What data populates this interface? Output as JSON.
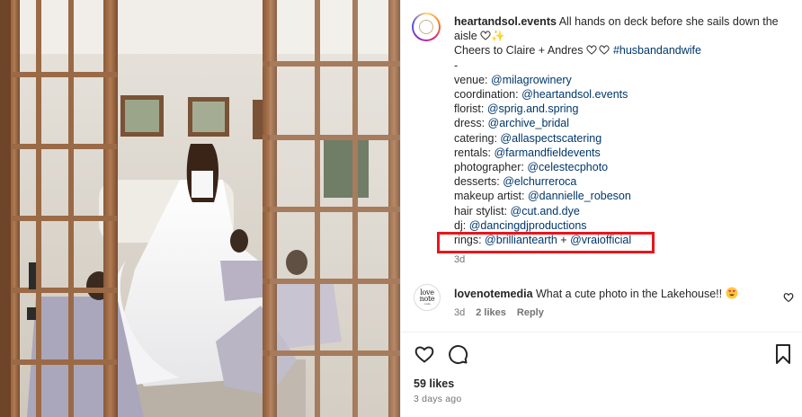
{
  "post": {
    "username": "heartandsol.events",
    "caption_text": " All hands on deck before she sails down the aisle ",
    "caption_emojis": "✨",
    "line_cheers": "Cheers to Claire + Andres ",
    "hashtag": "#husbandandwife",
    "dash": "-",
    "credits": [
      {
        "label": "venue: ",
        "mentions": [
          "@milagrowinery"
        ]
      },
      {
        "label": "coordination: ",
        "mentions": [
          "@heartandsol.events"
        ]
      },
      {
        "label": "florist: ",
        "mentions": [
          "@sprig.and.spring"
        ]
      },
      {
        "label": "dress: ",
        "mentions": [
          "@archive_bridal"
        ]
      },
      {
        "label": "catering: ",
        "mentions": [
          "@allaspectscatering"
        ]
      },
      {
        "label": "rentals: ",
        "mentions": [
          "@farmandfieldevents"
        ]
      },
      {
        "label": "photographer: ",
        "mentions": [
          "@celestecphoto"
        ]
      },
      {
        "label": "desserts: ",
        "mentions": [
          "@elchurreroca"
        ]
      },
      {
        "label": "makeup artist: ",
        "mentions": [
          "@dannielle_robeson"
        ]
      },
      {
        "label": "hair stylist: ",
        "mentions": [
          "@cut.and.dye"
        ]
      },
      {
        "label": "dj: ",
        "mentions": [
          "@dancingdjproductions"
        ]
      },
      {
        "label": "rings: ",
        "mentions": [
          "@brilliantearth",
          "@vraiofficial"
        ],
        "joiner": " + "
      }
    ],
    "time_ago": "3d"
  },
  "comment": {
    "avatar_text": "love note",
    "avatar_sub": "media",
    "username": "lovenotemedia",
    "text": " What a cute photo in the Lakehouse!! ",
    "time_ago": "3d",
    "likes": "2 likes",
    "reply": "Reply"
  },
  "footer": {
    "likes": "59 likes",
    "date": "3 days ago"
  },
  "icons": {
    "like": "heart-icon",
    "comment": "comment-bubble-icon",
    "save": "bookmark-icon"
  },
  "colors": {
    "mention": "#00376b",
    "highlight": "#e8161b",
    "muted": "#737373"
  }
}
